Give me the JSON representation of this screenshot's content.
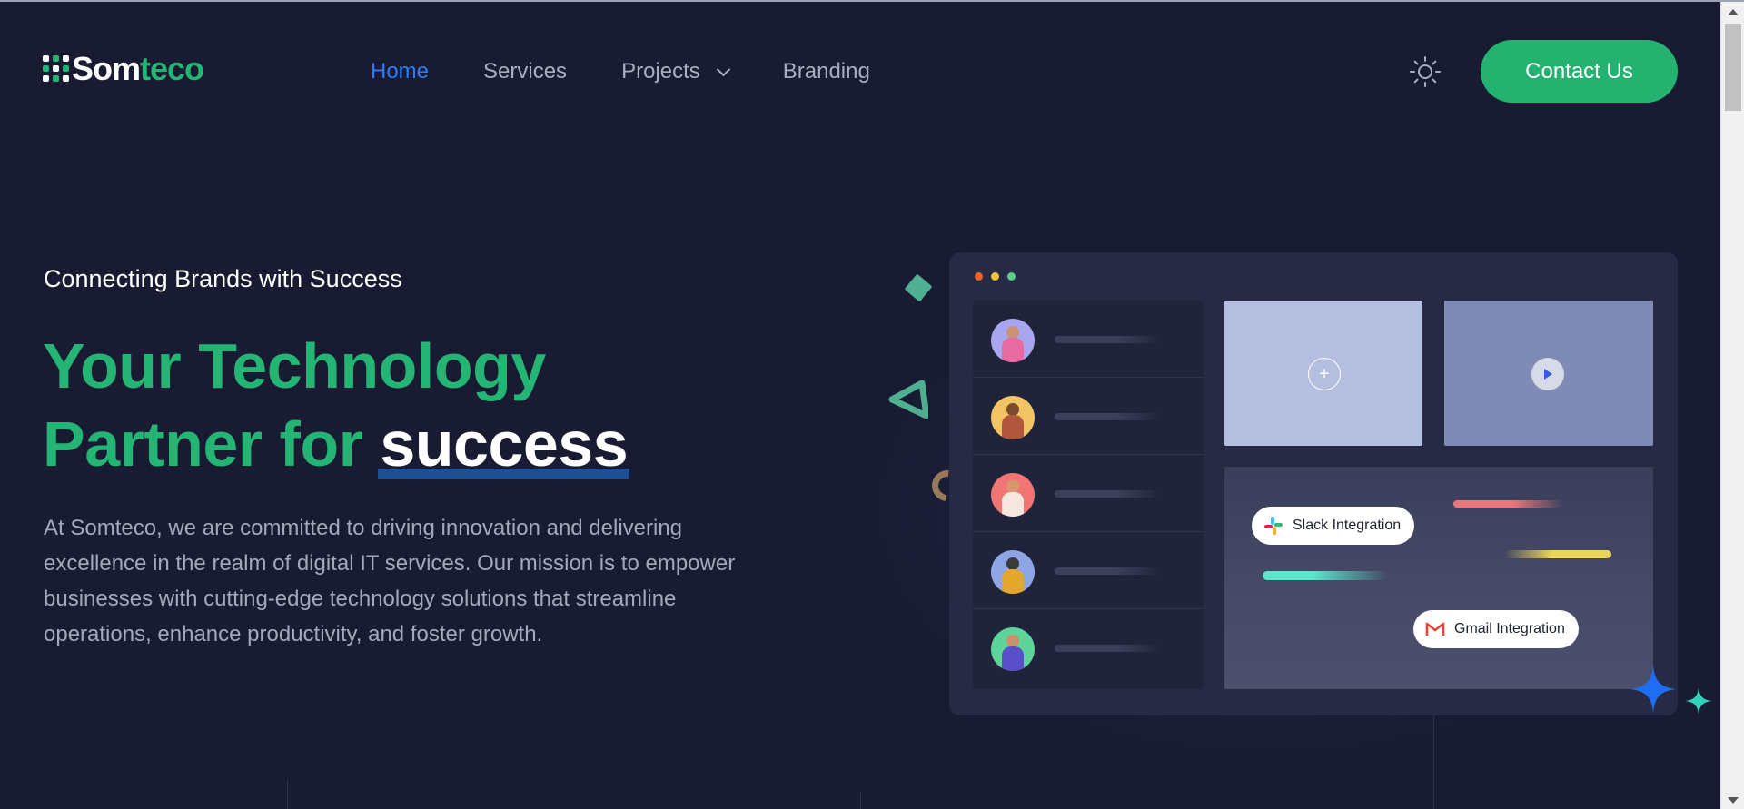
{
  "header": {
    "logo": {
      "part1": "Som",
      "part2": "teco"
    },
    "nav": [
      {
        "label": "Home",
        "active": true
      },
      {
        "label": "Services",
        "active": false
      },
      {
        "label": "Projects",
        "active": false,
        "has_dropdown": true
      },
      {
        "label": "Branding",
        "active": false
      }
    ],
    "theme_toggle_icon": "sun-icon",
    "contact_label": "Contact Us"
  },
  "hero": {
    "eyebrow": "Connecting Brands with Success",
    "headline_line1": "Your Technology",
    "headline_line2_prefix": "Partner for",
    "headline_accent": "success",
    "description": "At Somteco, we are committed to driving innovation and delivering excellence in the realm of digital IT services. Our mission is to empower businesses with cutting-edge technology solutions that streamline operations, enhance productivity, and foster growth."
  },
  "mockup": {
    "integrations": [
      {
        "label": "Slack Integration",
        "icon": "slack-icon"
      },
      {
        "label": "Gmail Integration",
        "icon": "gmail-icon"
      }
    ]
  },
  "colors": {
    "background": "#181b31",
    "brand_green": "#24b574",
    "nav_active": "#2f7cf6",
    "accent_highlight": "#1f4f92"
  }
}
